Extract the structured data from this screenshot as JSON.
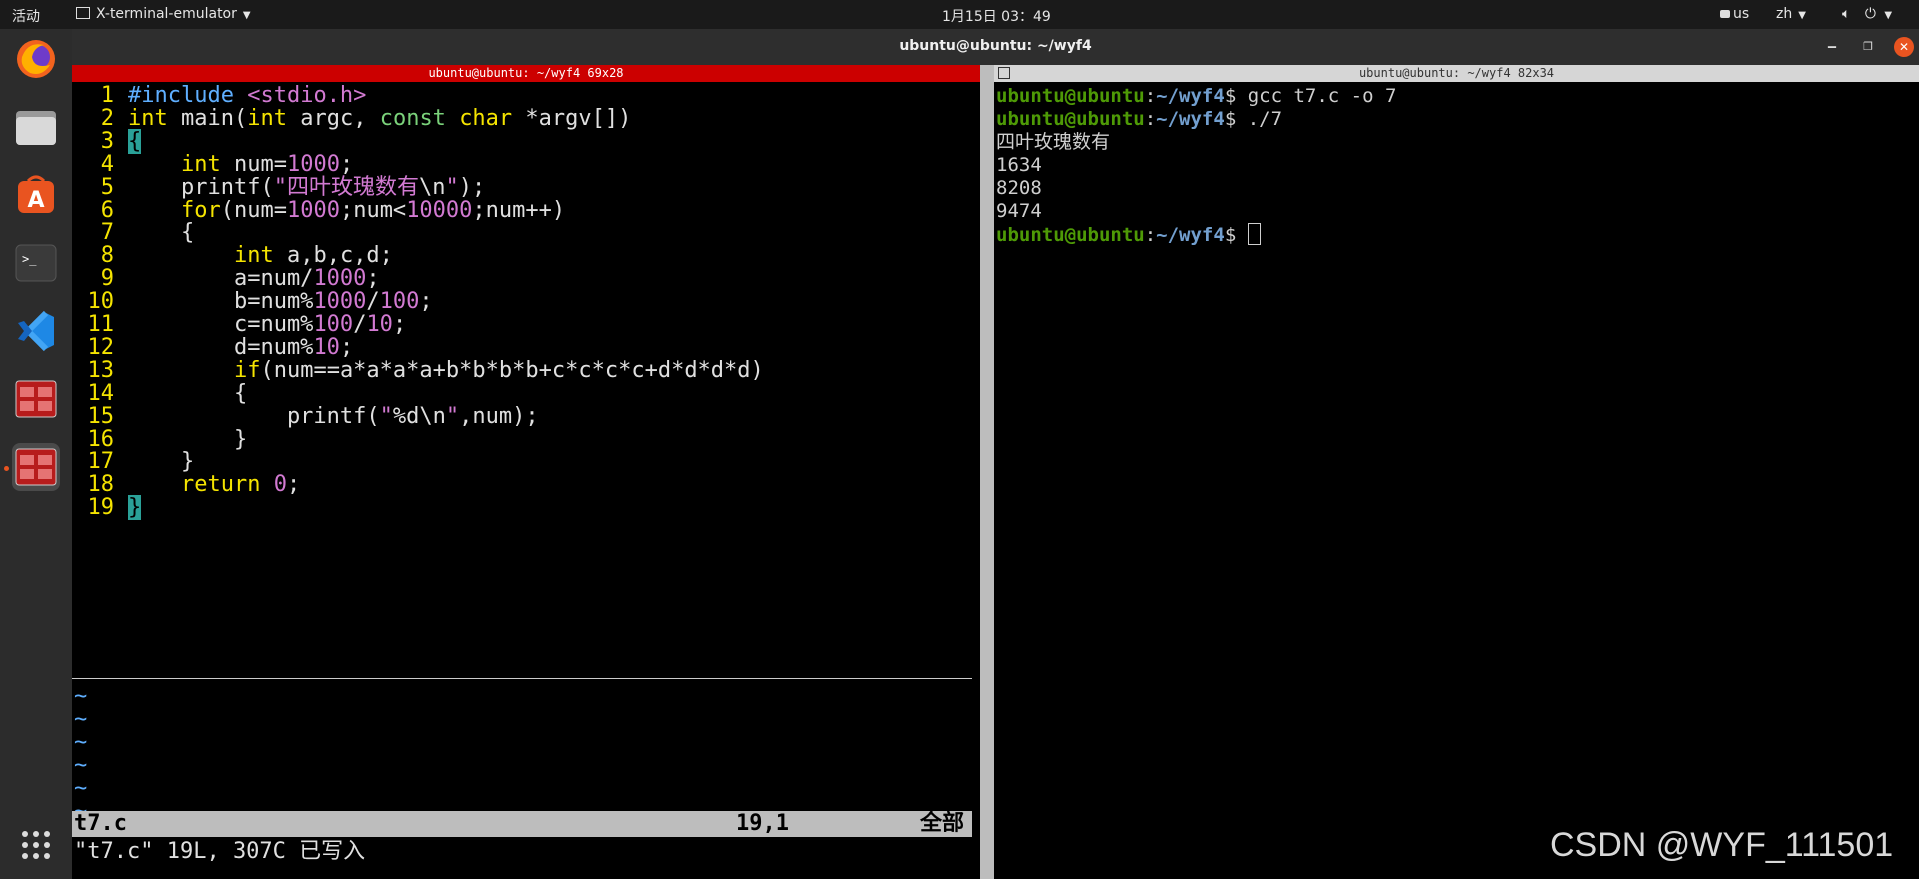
{
  "topbar": {
    "activities": "活动",
    "app_name": "X-terminal-emulator",
    "clock": "1月15日  03：49",
    "keyboard": "us",
    "input_method": "zh"
  },
  "window": {
    "title": "ubuntu@ubuntu: ~/wyf4"
  },
  "left_pane": {
    "title": "ubuntu@ubuntu: ~/wyf4 69x28",
    "line_numbers": [
      "1",
      "2",
      "3",
      "4",
      "5",
      "6",
      "7",
      "8",
      "9",
      "10",
      "11",
      "12",
      "13",
      "14",
      "15",
      "16",
      "17",
      "18",
      "19"
    ],
    "code_lines": [
      "#include <stdio.h>",
      "int main(int argc, const char *argv[])",
      "{",
      "    int num=1000;",
      "    printf(\"四叶玫瑰数有\\n\");",
      "    for(num=1000;num<10000;num++)",
      "    {",
      "        int a,b,c,d;",
      "        a=num/1000;",
      "        b=num%1000/100;",
      "        c=num%100/10;",
      "        d=num%10;",
      "        if(num==a*a*a*a+b*b*b*b+c*c*c*c+d*d*d*d)",
      "        {",
      "            printf(\"%d\\n\",num);",
      "        }",
      "    }",
      "    return 0;",
      "}"
    ],
    "status_file": "t7.c",
    "status_pos": "19,1",
    "status_all": "全部",
    "command_line": "\"t7.c\" 19L, 307C 已写入"
  },
  "right_pane": {
    "title": "ubuntu@ubuntu: ~/wyf4 82x34",
    "prompt_user": "ubuntu@ubuntu",
    "prompt_path": "~/wyf4",
    "cmd1": " gcc t7.c -o 7",
    "cmd2": " ./7",
    "outputs": [
      "四叶玫瑰数有",
      "1634",
      "8208",
      "9474"
    ]
  },
  "watermark": "CSDN @WYF_111501"
}
